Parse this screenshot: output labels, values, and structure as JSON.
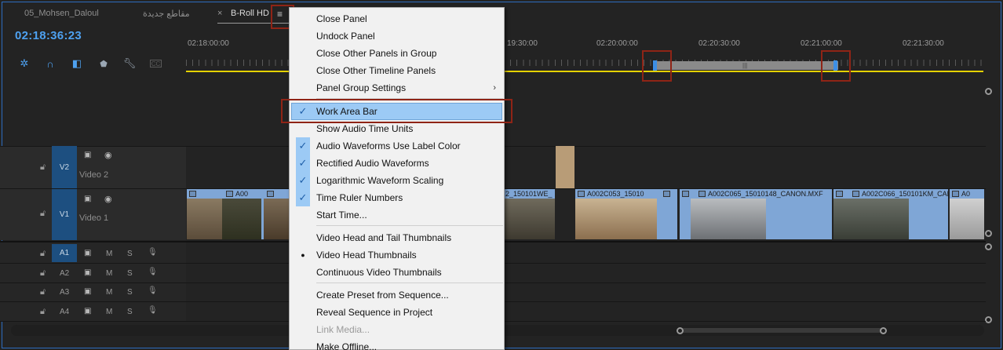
{
  "tabs": [
    {
      "label": "05_Mohsen_Daloul"
    },
    {
      "label": "مقاطع جديدة"
    },
    {
      "label": "B-Roll HD",
      "close": "×"
    }
  ],
  "timecode": "02:18:36:23",
  "ruler": {
    "labels": [
      "02:18:00:00",
      "19:30:00",
      "02:20:00:00",
      "02:20:30:00",
      "02:21:00:00",
      "02:21:30:00"
    ]
  },
  "tracks": {
    "video": [
      {
        "target": "V2",
        "name": "Video 2"
      },
      {
        "target": "V1",
        "name": "Video 1"
      }
    ],
    "audio": [
      {
        "target": "A1",
        "m": "M",
        "s": "S"
      },
      {
        "target": "A2",
        "m": "M",
        "s": "S"
      },
      {
        "target": "A3",
        "m": "M",
        "s": "S"
      },
      {
        "target": "A4",
        "m": "M",
        "s": "S"
      }
    ]
  },
  "clips": [
    "A00",
    "2_150101WE_",
    "A002C053_15010",
    "A002C065_15010148_CANON.MXF",
    "A002C066_150101KM_CAN",
    "A0"
  ],
  "menu": {
    "items": [
      {
        "label": "Close Panel"
      },
      {
        "label": "Undock Panel"
      },
      {
        "label": "Close Other Panels in Group"
      },
      {
        "label": "Close Other Timeline Panels"
      },
      {
        "label": "Panel Group Settings",
        "submenu": "›"
      },
      {
        "label": "Work Area Bar",
        "checked": "✓"
      },
      {
        "label": "Show Audio Time Units"
      },
      {
        "label": "Audio Waveforms Use Label Color",
        "checked": "✓"
      },
      {
        "label": "Rectified Audio Waveforms",
        "checked": "✓"
      },
      {
        "label": "Logarithmic Waveform Scaling",
        "checked": "✓"
      },
      {
        "label": "Time Ruler Numbers",
        "checked": "✓"
      },
      {
        "label": "Start Time..."
      },
      {
        "label": "Video Head and Tail Thumbnails"
      },
      {
        "label": "Video Head Thumbnails",
        "checked": "●"
      },
      {
        "label": "Continuous Video Thumbnails"
      },
      {
        "label": "Create Preset from Sequence..."
      },
      {
        "label": "Reveal Sequence in Project"
      },
      {
        "label": "Link Media..."
      },
      {
        "label": "Make Offline..."
      }
    ]
  },
  "colors": {
    "accent": "#4ea1f0",
    "work_area_line": "#e5d100",
    "clip": "#7fa6d6",
    "highlight": "#9ccaf5",
    "annotation": "#8f2416"
  },
  "icons": [
    "snap-icon",
    "linked-selection-icon",
    "add-marker-icon",
    "marker-icon",
    "wrench-icon",
    "captions-icon",
    "lock-icon",
    "toggle-output-icon",
    "eye-icon",
    "mic-icon",
    "panel-menu-icon"
  ]
}
